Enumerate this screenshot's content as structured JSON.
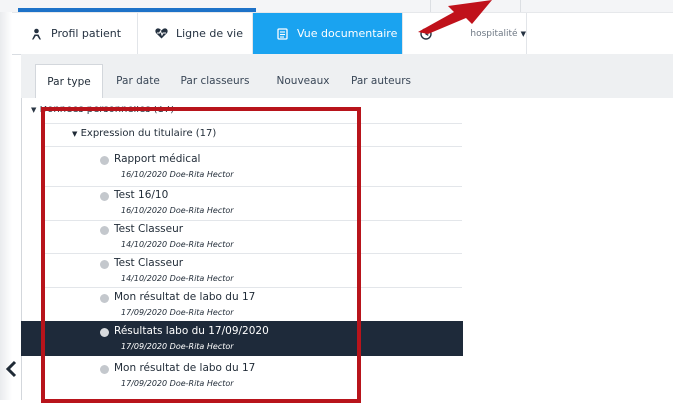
{
  "top_nav": {
    "tabs": [
      {
        "label": "Profil patient",
        "icon": "person-icon"
      },
      {
        "label": "Ligne de vie",
        "icon": "heart-icon"
      },
      {
        "label": "Vue documentaire",
        "icon": "document-icon",
        "active": true
      },
      {
        "label": "Hospitalité",
        "icon": "clock-icon",
        "visible_label": "hospitalité"
      }
    ]
  },
  "sub_tabs": [
    {
      "label": "Par type",
      "active": true
    },
    {
      "label": "Par date"
    },
    {
      "label": "Par classeurs"
    },
    {
      "label": "Nouveaux"
    },
    {
      "label": "Par auteurs"
    }
  ],
  "tree": {
    "group_label": "Données personnelles (17)",
    "subgroup_label": "Expression du titulaire (17)",
    "documents": [
      {
        "title": "Rapport médical",
        "meta": "16/10/2020 Doe-Rita Hector"
      },
      {
        "title": "Test 16/10",
        "meta": "16/10/2020 Doe-Rita Hector"
      },
      {
        "title": "Test Classeur",
        "meta": "14/10/2020 Doe-Rita Hector"
      },
      {
        "title": "Test Classeur",
        "meta": "14/10/2020 Doe-Rita Hector"
      },
      {
        "title": "Mon résultat de labo du 17",
        "meta": "17/09/2020 Doe-Rita Hector"
      },
      {
        "title": "Résultats labo du 17/09/2020",
        "meta": "17/09/2020 Doe-Rita Hector",
        "selected": true
      },
      {
        "title": "Mon résultat de labo du 17",
        "meta": "17/09/2020 Doe-Rita Hector"
      }
    ]
  },
  "colors": {
    "active_tab": "#1aa3f0",
    "selected_row": "#1e2a3a",
    "highlight": "#b8141b",
    "arrow": "#c0121b"
  }
}
